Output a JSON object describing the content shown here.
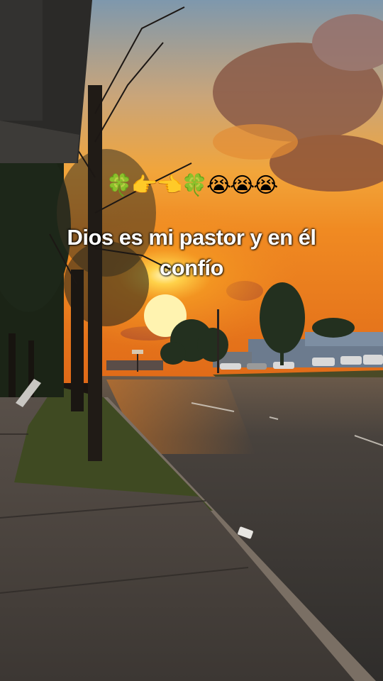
{
  "overlay": {
    "emoji_line": "🍀👉👈🍀😭😭😭",
    "caption": "Dios es mi pastor y en él confío"
  },
  "scene": {
    "description_icons": [
      "sunset",
      "road",
      "trees",
      "sidewalk",
      "parked-cars"
    ],
    "colors": {
      "sky_top": "#7fa3c0",
      "sky_orange": "#f59a2a",
      "sun": "#fff2a8",
      "road": "#3d3a38",
      "grass": "#4f5a2c",
      "sidewalk": "#5e5a55"
    }
  }
}
